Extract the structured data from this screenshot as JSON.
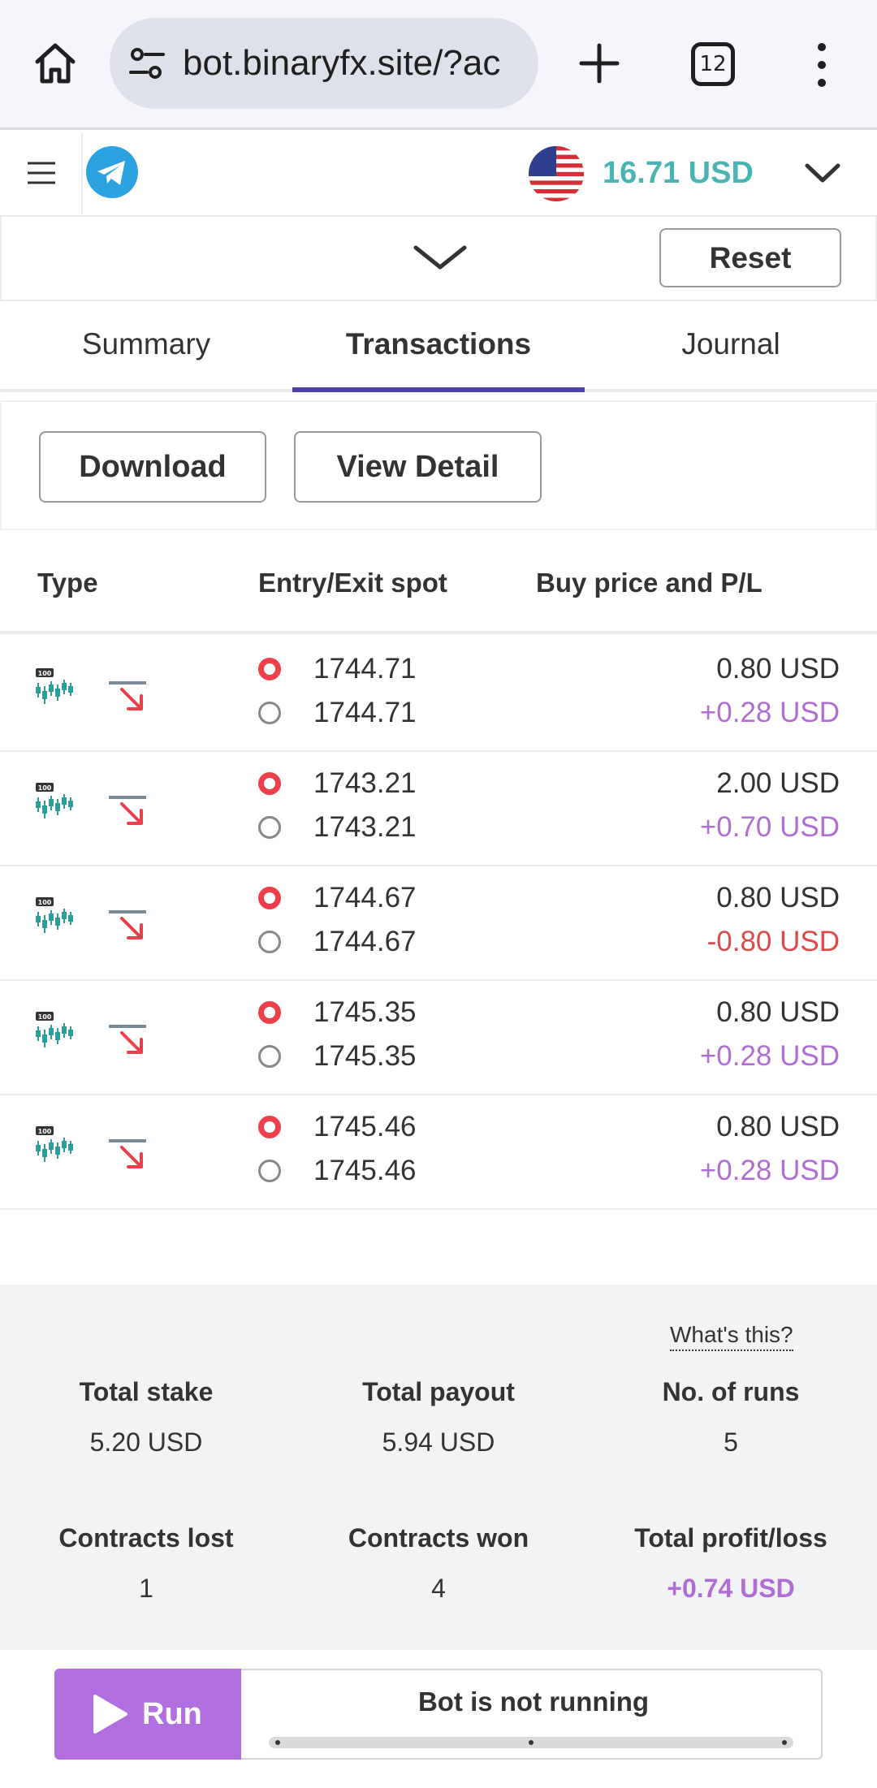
{
  "browser": {
    "url": "bot.binaryfx.site/?ac",
    "tab_count": "12"
  },
  "header": {
    "balance": "16.71 USD"
  },
  "toolbar": {
    "reset_label": "Reset"
  },
  "tabs": [
    {
      "label": "Summary"
    },
    {
      "label": "Transactions"
    },
    {
      "label": "Journal"
    }
  ],
  "actions": {
    "download_label": "Download",
    "view_detail_label": "View Detail"
  },
  "table": {
    "columns": [
      "Type",
      "Entry/Exit spot",
      "Buy price and P/L"
    ],
    "rows": [
      {
        "entry": "1744.71",
        "exit": "1744.71",
        "buy_price": "0.80 USD",
        "pl": "+0.28 USD"
      },
      {
        "entry": "1743.21",
        "exit": "1743.21",
        "buy_price": "2.00 USD",
        "pl": "+0.70 USD"
      },
      {
        "entry": "1744.67",
        "exit": "1744.67",
        "buy_price": "0.80 USD",
        "pl": "-0.80 USD"
      },
      {
        "entry": "1745.35",
        "exit": "1745.35",
        "buy_price": "0.80 USD",
        "pl": "+0.28 USD"
      },
      {
        "entry": "1745.46",
        "exit": "1745.46",
        "buy_price": "0.80 USD",
        "pl": "+0.28 USD"
      }
    ],
    "asset_badge": "100"
  },
  "summary": {
    "whats_this": "What's this?",
    "total_stake_label": "Total stake",
    "total_stake": "5.20 USD",
    "total_payout_label": "Total payout",
    "total_payout": "5.94 USD",
    "runs_label": "No. of runs",
    "runs": "5",
    "lost_label": "Contracts lost",
    "lost": "1",
    "won_label": "Contracts won",
    "won": "4",
    "profit_label": "Total profit/loss",
    "profit": "+0.74 USD"
  },
  "run_bar": {
    "run_label": "Run",
    "status": "Bot is not running"
  },
  "colors": {
    "accent_teal": "#4bb4b3",
    "tab_indicator": "#4a3fa8",
    "profit": "#b06dd6",
    "loss": "#e04848",
    "run_button": "#b26fe0",
    "entry_marker": "#ec3f4b"
  },
  "icons": {
    "home": "home-icon",
    "site_settings": "tune-icon",
    "new_tab": "plus-icon",
    "menu": "more-vert-icon",
    "hamburger": "hamburger-icon",
    "telegram": "telegram-icon",
    "flag": "us-flag-icon",
    "chevron": "chevron-down-icon",
    "asset": "volatility-100-index-icon",
    "contract": "fall-contract-icon",
    "play": "play-icon"
  }
}
